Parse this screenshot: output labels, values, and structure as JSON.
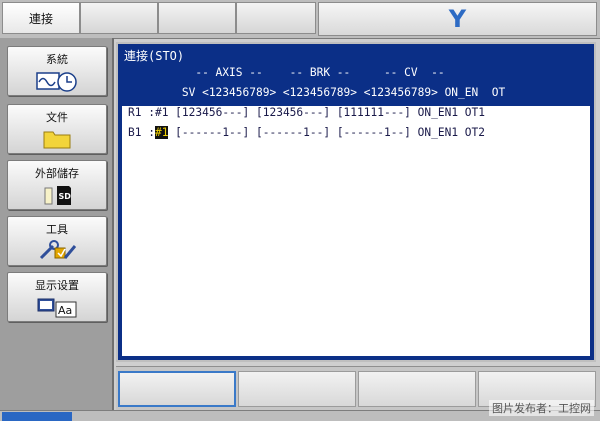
{
  "topbar": {
    "tabs": [
      "連接",
      "",
      "",
      ""
    ],
    "title": "Y"
  },
  "left_menu": [
    {
      "label": "系統",
      "icon": "wave-clock-icon"
    },
    {
      "label": "文件",
      "icon": "folder-icon"
    },
    {
      "label": "外部儲存",
      "icon": "sd-card-icon"
    },
    {
      "label": "工具",
      "icon": "tools-icon"
    },
    {
      "label": "显示设置",
      "icon": "display-font-icon"
    }
  ],
  "main": {
    "caption": "連接(STO)",
    "header_line1": "          -- AXIS --    -- BRK --     -- CV  --",
    "header_line2": "        SV <123456789> <123456789> <123456789> ON_EN  OT",
    "rows": [
      {
        "prefix": "R1 :",
        "cursor": "#1",
        "text": " [123456---] [123456---] [111111---] ON_EN1 OT1"
      },
      {
        "prefix": "B1 :",
        "cursor": "#1",
        "text": " [------1--] [------1--] [------1--] ON_EN1 OT2"
      }
    ]
  },
  "watermark": "图片发布者：工控网"
}
